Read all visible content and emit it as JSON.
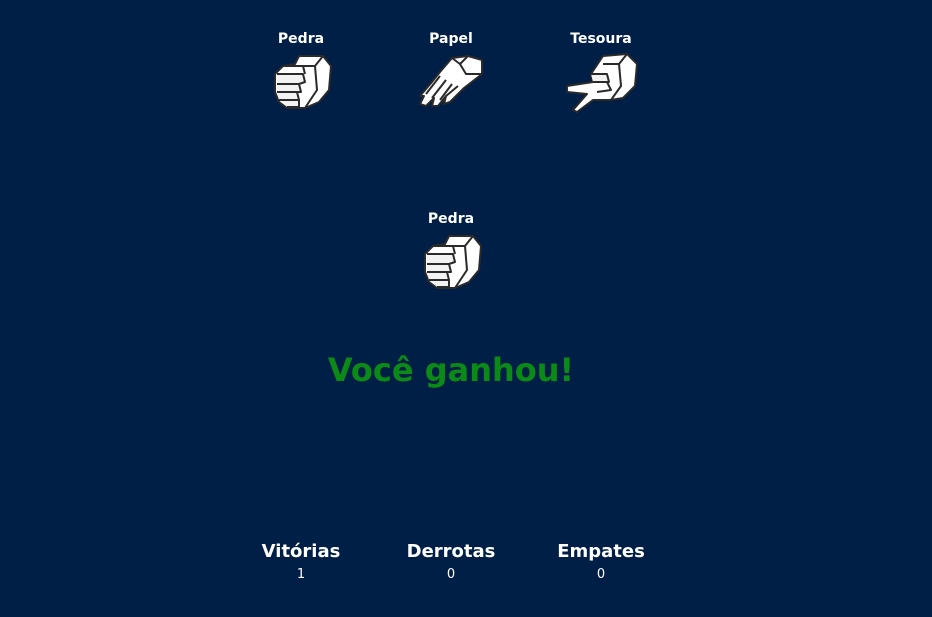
{
  "choices": {
    "rock": {
      "label": "Pedra",
      "icon": "fist-icon"
    },
    "paper": {
      "label": "Papel",
      "icon": "open-hand-icon"
    },
    "scissors": {
      "label": "Tesoura",
      "icon": "two-fingers-icon"
    }
  },
  "computer": {
    "label": "Pedra",
    "icon": "fist-icon"
  },
  "result": {
    "text": "Você ganhou!",
    "color": "#0c8a16"
  },
  "scoreboard": {
    "wins": {
      "label": "Vitórias",
      "value": "1"
    },
    "losses": {
      "label": "Derrotas",
      "value": "0"
    },
    "draws": {
      "label": "Empates",
      "value": "0"
    }
  },
  "colors": {
    "background": "#001f47",
    "text": "#ffffff",
    "win": "#0c8a16"
  }
}
